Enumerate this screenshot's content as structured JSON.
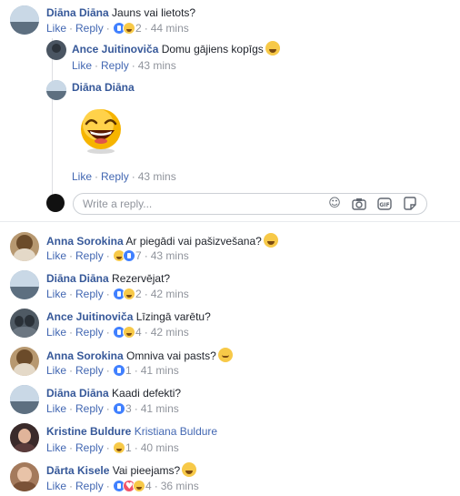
{
  "thread": {
    "parent": {
      "author": "Diāna Diāna",
      "text": "Jauns vai lietots?",
      "like": "Like",
      "reply": "Reply",
      "reactions_count": "2",
      "time": "44 mins"
    },
    "replies": [
      {
        "author": "Ance Juitinoviča",
        "text": "Domu gājiens kopīgs",
        "like": "Like",
        "reply": "Reply",
        "time": "43 mins"
      },
      {
        "author": "Diāna Diāna",
        "text": "",
        "sticker": "laughing-face-sticker",
        "like": "Like",
        "reply": "Reply",
        "time": "43 mins"
      }
    ],
    "reply_input": {
      "placeholder": "Write a reply..."
    },
    "reply_icons": [
      "emoji-icon",
      "camera-icon",
      "gif-icon",
      "sticker-icon"
    ]
  },
  "comments": [
    {
      "author": "Anna Sorokina",
      "text": "Ar piegādi vai pašizvešana?",
      "emoji": "grin",
      "like": "Like",
      "reply": "Reply",
      "reactions": [
        "haha",
        "like"
      ],
      "reactions_count": "7",
      "time": "43 mins"
    },
    {
      "author": "Diāna Diāna",
      "text": "Rezervējat?",
      "emoji": "",
      "like": "Like",
      "reply": "Reply",
      "reactions": [
        "like",
        "haha"
      ],
      "reactions_count": "2",
      "time": "42 mins"
    },
    {
      "author": "Ance Juitinoviča",
      "text": "Līzingā varētu?",
      "emoji": "",
      "like": "Like",
      "reply": "Reply",
      "reactions": [
        "like",
        "haha"
      ],
      "reactions_count": "4",
      "time": "42 mins"
    },
    {
      "author": "Anna Sorokina",
      "text": "Omniva vai pasts?",
      "emoji": "smile",
      "like": "Like",
      "reply": "Reply",
      "reactions": [
        "like"
      ],
      "reactions_count": "1",
      "time": "41 mins"
    },
    {
      "author": "Diāna Diāna",
      "text": "Kaadi defekti?",
      "emoji": "",
      "like": "Like",
      "reply": "Reply",
      "reactions": [
        "like"
      ],
      "reactions_count": "3",
      "time": "41 mins"
    },
    {
      "author": "Kristine Buldure",
      "text": "Kristiana Buldure",
      "emoji": "",
      "like": "Like",
      "reply": "Reply",
      "reactions": [
        "haha"
      ],
      "reactions_count": "1",
      "time": "40 mins"
    },
    {
      "author": "Dārta Kisele",
      "text": "Vai pieejams?",
      "emoji": "grin",
      "like": "Like",
      "reply": "Reply",
      "reactions": [
        "like",
        "love",
        "haha"
      ],
      "reactions_count": "4",
      "time": "36 mins"
    }
  ],
  "colors": {
    "name": "#365899",
    "link": "#4267b2",
    "meta": "#90949c",
    "like_reaction": "#4080ff",
    "haha_reaction": "#f7c948",
    "love_reaction": "#f25268"
  }
}
